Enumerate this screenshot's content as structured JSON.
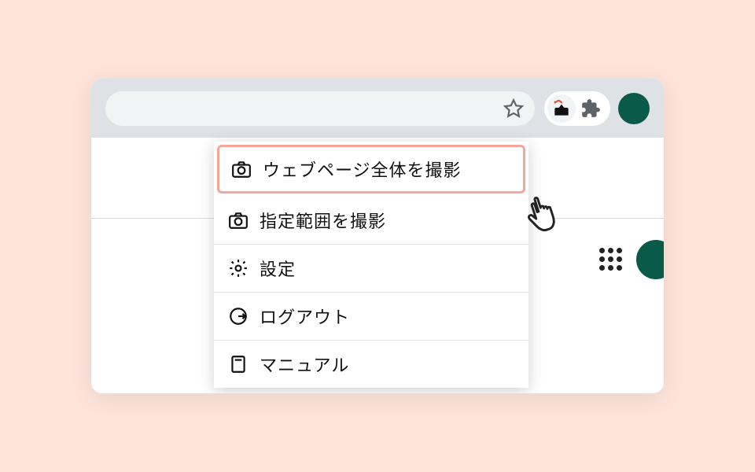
{
  "menu": {
    "items": [
      {
        "label": "ウェブページ全体を撮影"
      },
      {
        "label": "指定範囲を撮影"
      },
      {
        "label": "設定"
      },
      {
        "label": "ログアウト"
      },
      {
        "label": "マニュアル"
      }
    ]
  }
}
